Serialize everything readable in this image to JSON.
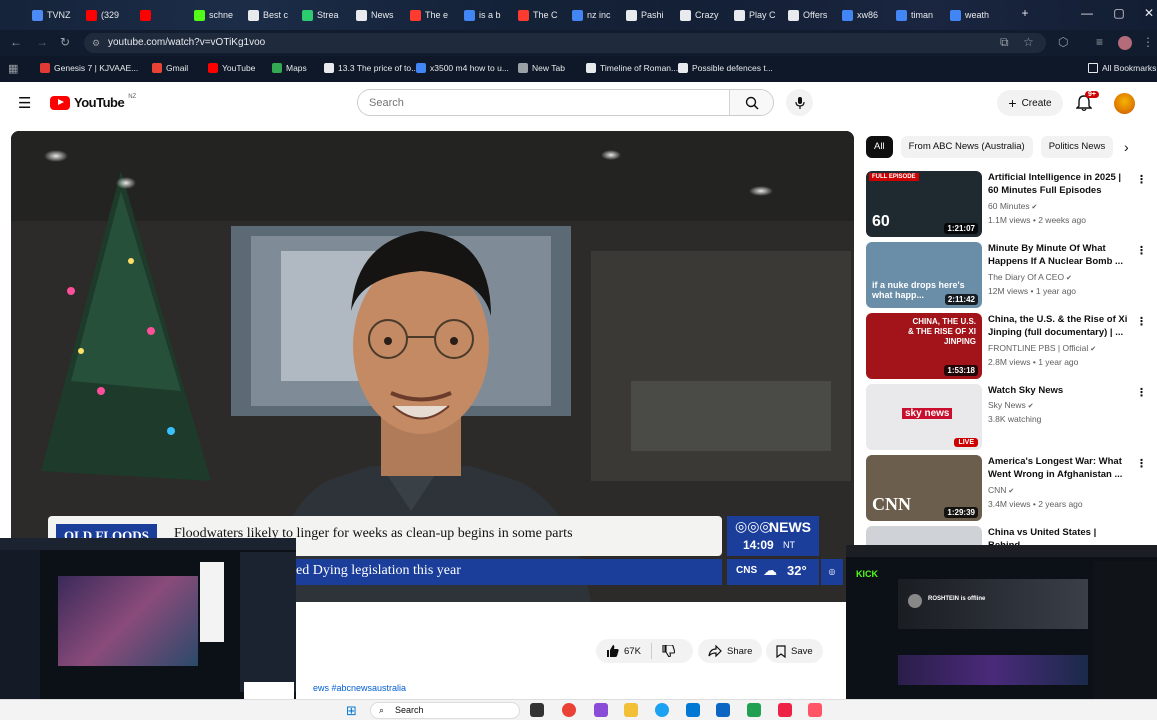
{
  "browser": {
    "tabs": [
      {
        "label": "TVNZ",
        "color": "#4c8bf5"
      },
      {
        "label": "(329",
        "color": "#ff0000"
      },
      {
        "label": "",
        "color": "#ff0000"
      },
      {
        "label": "schne",
        "color": "#53fc18"
      },
      {
        "label": "Best c",
        "color": "#e8eaed"
      },
      {
        "label": "Strea",
        "color": "#2ecc71"
      },
      {
        "label": "News",
        "color": "#e8eaed"
      },
      {
        "label": "The e",
        "color": "#ff3b30"
      },
      {
        "label": "is a b",
        "color": "#4285f4"
      },
      {
        "label": "The C",
        "color": "#ff3b30"
      },
      {
        "label": "nz inc",
        "color": "#4285f4"
      },
      {
        "label": "Pashi",
        "color": "#e8eaed"
      },
      {
        "label": "Crazy",
        "color": "#e8eaed"
      },
      {
        "label": "Play C",
        "color": "#e8eaed"
      },
      {
        "label": "Offers",
        "color": "#e8eaed"
      },
      {
        "label": "xw86",
        "color": "#4285f4"
      },
      {
        "label": "timan",
        "color": "#4285f4"
      },
      {
        "label": "weath",
        "color": "#4285f4"
      }
    ],
    "url": "youtube.com/watch?v=vOTiKg1voo",
    "bookmarks": [
      {
        "label": "Genesis 7 | KJVAAE...",
        "color": "#e53935"
      },
      {
        "label": "Gmail",
        "color": "#ea4335"
      },
      {
        "label": "YouTube",
        "color": "#ff0000"
      },
      {
        "label": "Maps",
        "color": "#34a853"
      },
      {
        "label": "13.3 The price of to...",
        "color": "#e8eaed"
      },
      {
        "label": "x3500 m4 how to u...",
        "color": "#4285f4"
      },
      {
        "label": "New Tab",
        "color": "#9aa0a6"
      },
      {
        "label": "Timeline of Roman...",
        "color": "#e8eaed"
      },
      {
        "label": "Possible defences t...",
        "color": "#e8eaed"
      }
    ],
    "all_bookmarks": "All Bookmarks"
  },
  "youtube": {
    "logo_text": "YouTube",
    "region": "NZ",
    "search_placeholder": "Search",
    "create_label": "Create",
    "notif_count": "9+"
  },
  "video": {
    "ticker_tag": "OLD FLOODS",
    "ticker_headline": "Floodwaters likely to linger for weeks as clean-up begins in some parts",
    "ticker_second": "ed Dying legislation this year",
    "news_brand": "NEWS",
    "news_time": "14:09",
    "news_tz": "NT",
    "weather_city": "CNS",
    "weather_temp": "32°",
    "hashtag": "ews #abcnewsaustralia"
  },
  "actions": {
    "like_count": "67K",
    "share_label": "Share",
    "save_label": "Save"
  },
  "chips": [
    {
      "label": "All",
      "active": true
    },
    {
      "label": "From ABC News (Australia)",
      "active": false
    },
    {
      "label": "Politics News",
      "active": false
    }
  ],
  "recommendations": [
    {
      "title": "Artificial Intelligence in 2025 | 60 Minutes Full Episodes",
      "channel": "60 Minutes",
      "verified": true,
      "meta": "1.1M views • 2 weeks ago",
      "duration": "1:21:07",
      "badge": "FULL EPISODE",
      "thumb_overlay": "60",
      "thumb_bg": "#1e2a30"
    },
    {
      "title": "Minute By Minute Of What Happens If A Nuclear Bomb ...",
      "channel": "The Diary Of A CEO",
      "verified": true,
      "meta": "12M views • 1 year ago",
      "duration": "2:11:42",
      "badge": "",
      "thumb_overlay": "if a nuke drops here's what happ...",
      "thumb_bg": "#6a8ea8"
    },
    {
      "title": "China, the U.S. & the Rise of Xi Jinping (full documentary) | ...",
      "channel": "FRONTLINE PBS | Official",
      "verified": true,
      "meta": "2.8M views • 1 year ago",
      "duration": "1:53:18",
      "badge": "",
      "thumb_overlay": "CHINA, THE U.S. & THE RISE OF XI JINPING",
      "thumb_bg": "#a3141a"
    },
    {
      "title": "Watch Sky News",
      "channel": "Sky News",
      "verified": true,
      "meta": "3.8K watching",
      "duration": "",
      "badge": "",
      "thumb_overlay": "sky news",
      "live_label": "LIVE",
      "thumb_bg": "#e9e9ec"
    },
    {
      "title": "America's Longest War: What Went Wrong in Afghanistan ...",
      "channel": "CNN",
      "verified": true,
      "meta": "3.4M views • 2 years ago",
      "duration": "1:29:39",
      "badge": "",
      "thumb_overlay": "CNN",
      "thumb_bg": "#6b5e4c"
    },
    {
      "title": "China vs United States | Behind",
      "channel": "",
      "verified": false,
      "meta": "",
      "duration": "",
      "badge": "",
      "thumb_overlay": "",
      "thumb_bg": "#cfd3d8"
    }
  ],
  "taskbar": {
    "search_label": "Search"
  },
  "overlays": {
    "kick_channel": "ROSHTEIN is offline",
    "kick_logo": "KICK"
  }
}
